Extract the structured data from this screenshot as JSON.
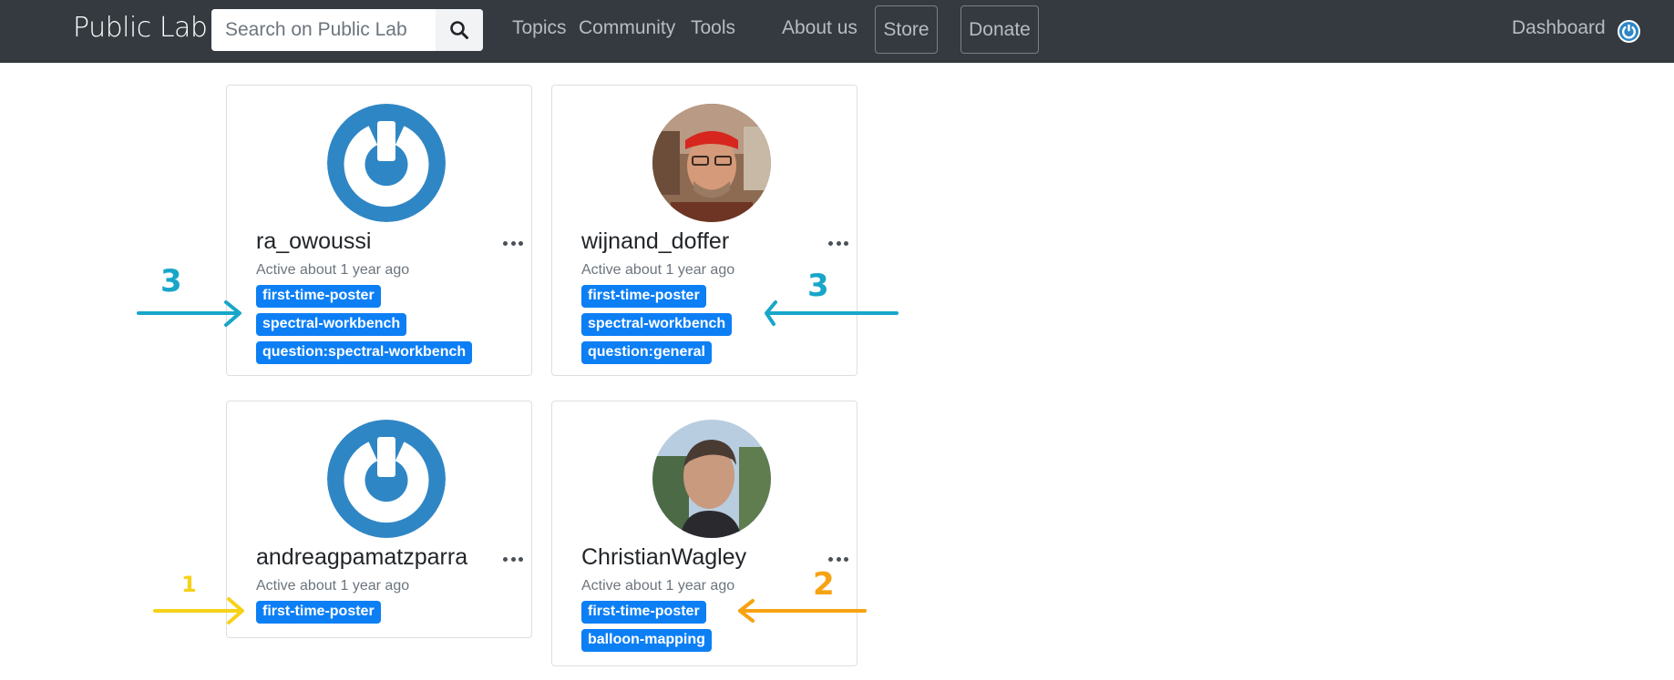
{
  "header": {
    "brand": "Public Lab",
    "search_placeholder": "Search on Public Lab",
    "nav": {
      "topics": "Topics",
      "community": "Community",
      "tools": "Tools",
      "about": "About us",
      "store": "Store",
      "donate": "Donate",
      "dashboard": "Dashboard"
    }
  },
  "users": [
    {
      "username": "ra_owoussi",
      "activity": "Active about 1 year ago",
      "tags": [
        "first-time-poster",
        "spectral-workbench",
        "question:spectral-workbench"
      ],
      "avatar": "default-power-avatar"
    },
    {
      "username": "wijnand_doffer",
      "activity": "Active about 1 year ago",
      "tags": [
        "first-time-poster",
        "spectral-workbench",
        "question:general"
      ],
      "avatar": "photo-avatar"
    },
    {
      "username": "andreagpamatzparra",
      "activity": "Active about 1 year ago",
      "tags": [
        "first-time-poster"
      ],
      "avatar": "default-power-avatar"
    },
    {
      "username": "ChristianWagley",
      "activity": "Active about 1 year ago",
      "tags": [
        "first-time-poster",
        "balloon-mapping"
      ],
      "avatar": "photo-avatar"
    }
  ],
  "annotations": [
    {
      "label": "3",
      "color": "#18a6c9"
    },
    {
      "label": "3",
      "color": "#18a6c9"
    },
    {
      "label": "1",
      "color": "#f6d21a"
    },
    {
      "label": "2",
      "color": "#f6a313"
    }
  ],
  "colors": {
    "navbar": "#343a40",
    "tag": "#0d7ff5",
    "avatar_blue": "#2f86c5"
  }
}
